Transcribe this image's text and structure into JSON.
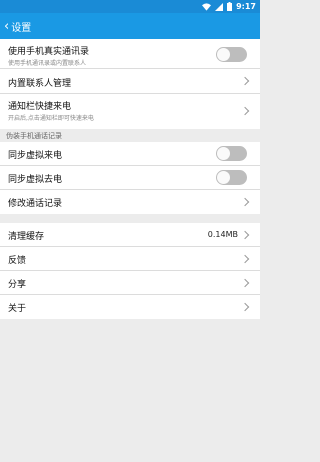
{
  "status_bar": {
    "time": "9:17"
  },
  "app_bar": {
    "back_label": "设置"
  },
  "section1": {
    "rows": [
      {
        "title": "使用手机真实通讯录",
        "subtitle": "使用手机通讯录或内置联系人"
      },
      {
        "title": "内置联系人管理"
      },
      {
        "title": "通知栏快捷来电",
        "subtitle": "开启后,点击通知栏即可快速来电"
      }
    ]
  },
  "section2": {
    "header": "伪装手机通话记录",
    "rows": [
      {
        "title": "同步虚拟来电"
      },
      {
        "title": "同步虚拟去电"
      },
      {
        "title": "修改通话记录"
      }
    ]
  },
  "section3": {
    "rows": [
      {
        "title": "清理缓存",
        "value": "0.14MB"
      },
      {
        "title": "反馈"
      },
      {
        "title": "分享"
      },
      {
        "title": "关于"
      }
    ]
  }
}
